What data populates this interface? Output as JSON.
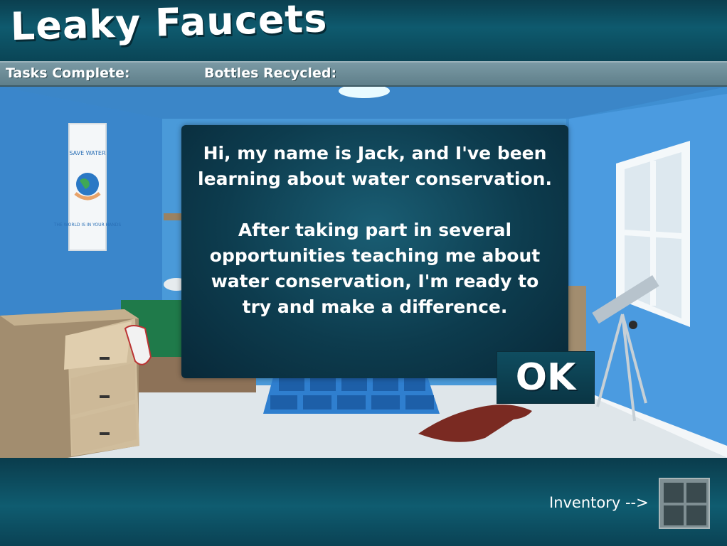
{
  "header": {
    "title": "Leaky Faucets"
  },
  "status": {
    "tasks_label": "Tasks Complete:",
    "bottles_label": "Bottles Recycled:"
  },
  "dialog": {
    "paragraph1": "Hi, my name is Jack, and I've been learning about water conservation.",
    "paragraph2": "After taking part in several opportunities teaching me about water conservation, I'm ready to try and make a difference.",
    "ok_label": "OK"
  },
  "scene": {
    "poster": {
      "top": "SAVE WATER",
      "bottom": "THE WORLD IS IN YOUR HANDS"
    }
  },
  "footer": {
    "inventory_label": "Inventory -->"
  },
  "colors": {
    "wall": "#3f8fd2",
    "panel": "#0d3c4e",
    "floor": "#dfe6ea"
  }
}
